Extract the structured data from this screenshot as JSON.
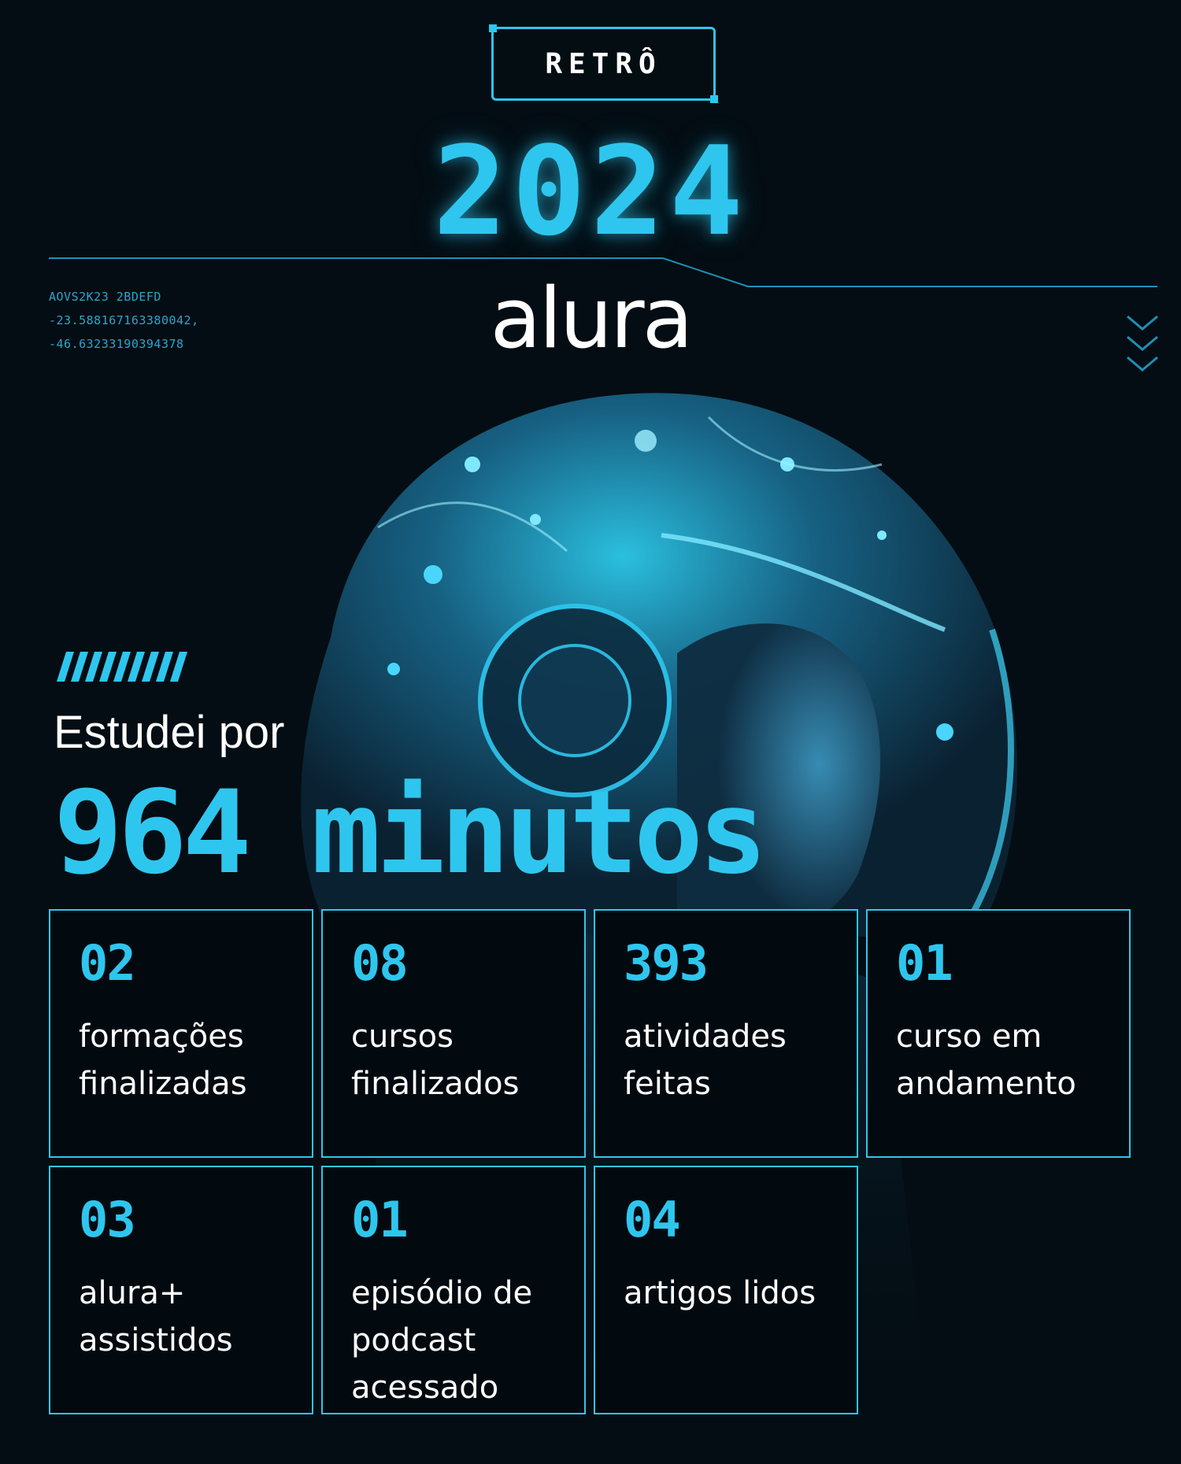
{
  "header": {
    "badge_label": "RETRÔ",
    "year": "2024",
    "brand": "alura",
    "coordinates": [
      "AOVS2K23 2BDEFD",
      "-23.588167163380042,",
      "-46.63233190394378"
    ]
  },
  "summary": {
    "label": "Estudei por",
    "value": "964 minutos"
  },
  "stats": [
    {
      "value": "02",
      "label": "formações finalizadas"
    },
    {
      "value": "08",
      "label": "cursos finalizados"
    },
    {
      "value": "393",
      "label": "atividades feitas"
    },
    {
      "value": "01",
      "label": "curso em andamento"
    },
    {
      "value": "03",
      "label": "alura+ assistidos"
    },
    {
      "value": "01",
      "label": "episódio de podcast acessado"
    },
    {
      "value": "04",
      "label": "artigos lidos"
    }
  ],
  "icons": {
    "chevrons": "chevron-down-icon",
    "stripes": "stripes-icon",
    "hero": "astronaut-illustration"
  },
  "colors": {
    "background": "#040d13",
    "accent": "#2ec6ee",
    "text": "#ffffff"
  }
}
